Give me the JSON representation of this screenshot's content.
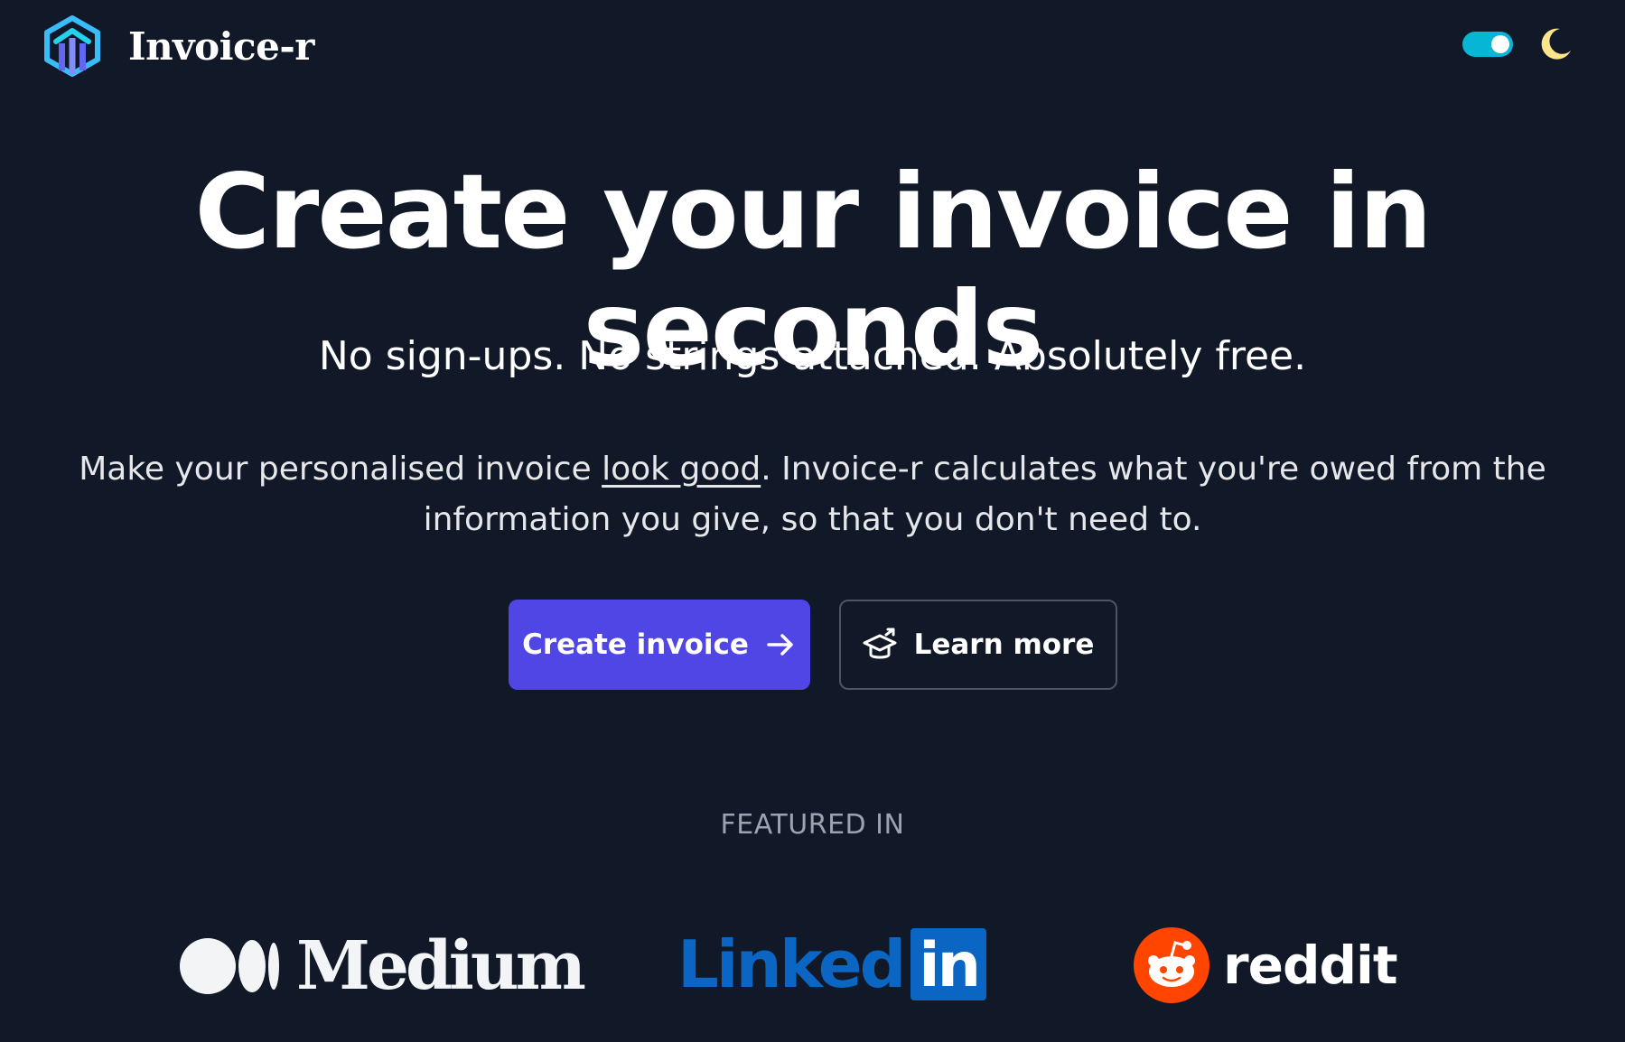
{
  "header": {
    "brand": "Invoice-r",
    "logo_icon": "invoice-r-logo-icon",
    "theme_toggle": {
      "state": "on",
      "color": "#06b6d4"
    },
    "theme_icon": "moon-icon"
  },
  "hero": {
    "title": "Create your invoice in seconds",
    "tagline": "No sign-ups. No strings attached. Absolutely free.",
    "description_before": "Make your personalised invoice ",
    "description_link": "look good",
    "description_after": ". Invoice-r calculates what you're owed from the information you give, so that you don't need to."
  },
  "buttons": {
    "primary_label": "Create invoice",
    "primary_icon": "arrow-right-icon",
    "secondary_label": "Learn more",
    "secondary_icon": "graduation-cap-icon"
  },
  "featured": {
    "label": "FEATURED IN",
    "logos": {
      "medium": "Medium",
      "linkedin_text": "Linked",
      "linkedin_box": "in",
      "reddit": "reddit"
    }
  },
  "colors": {
    "background": "#111827",
    "primary": "#4f46e5",
    "accent": "#06b6d4",
    "linkedin": "#0a66c2",
    "reddit": "#ff4500",
    "moon": "#fde68a"
  }
}
